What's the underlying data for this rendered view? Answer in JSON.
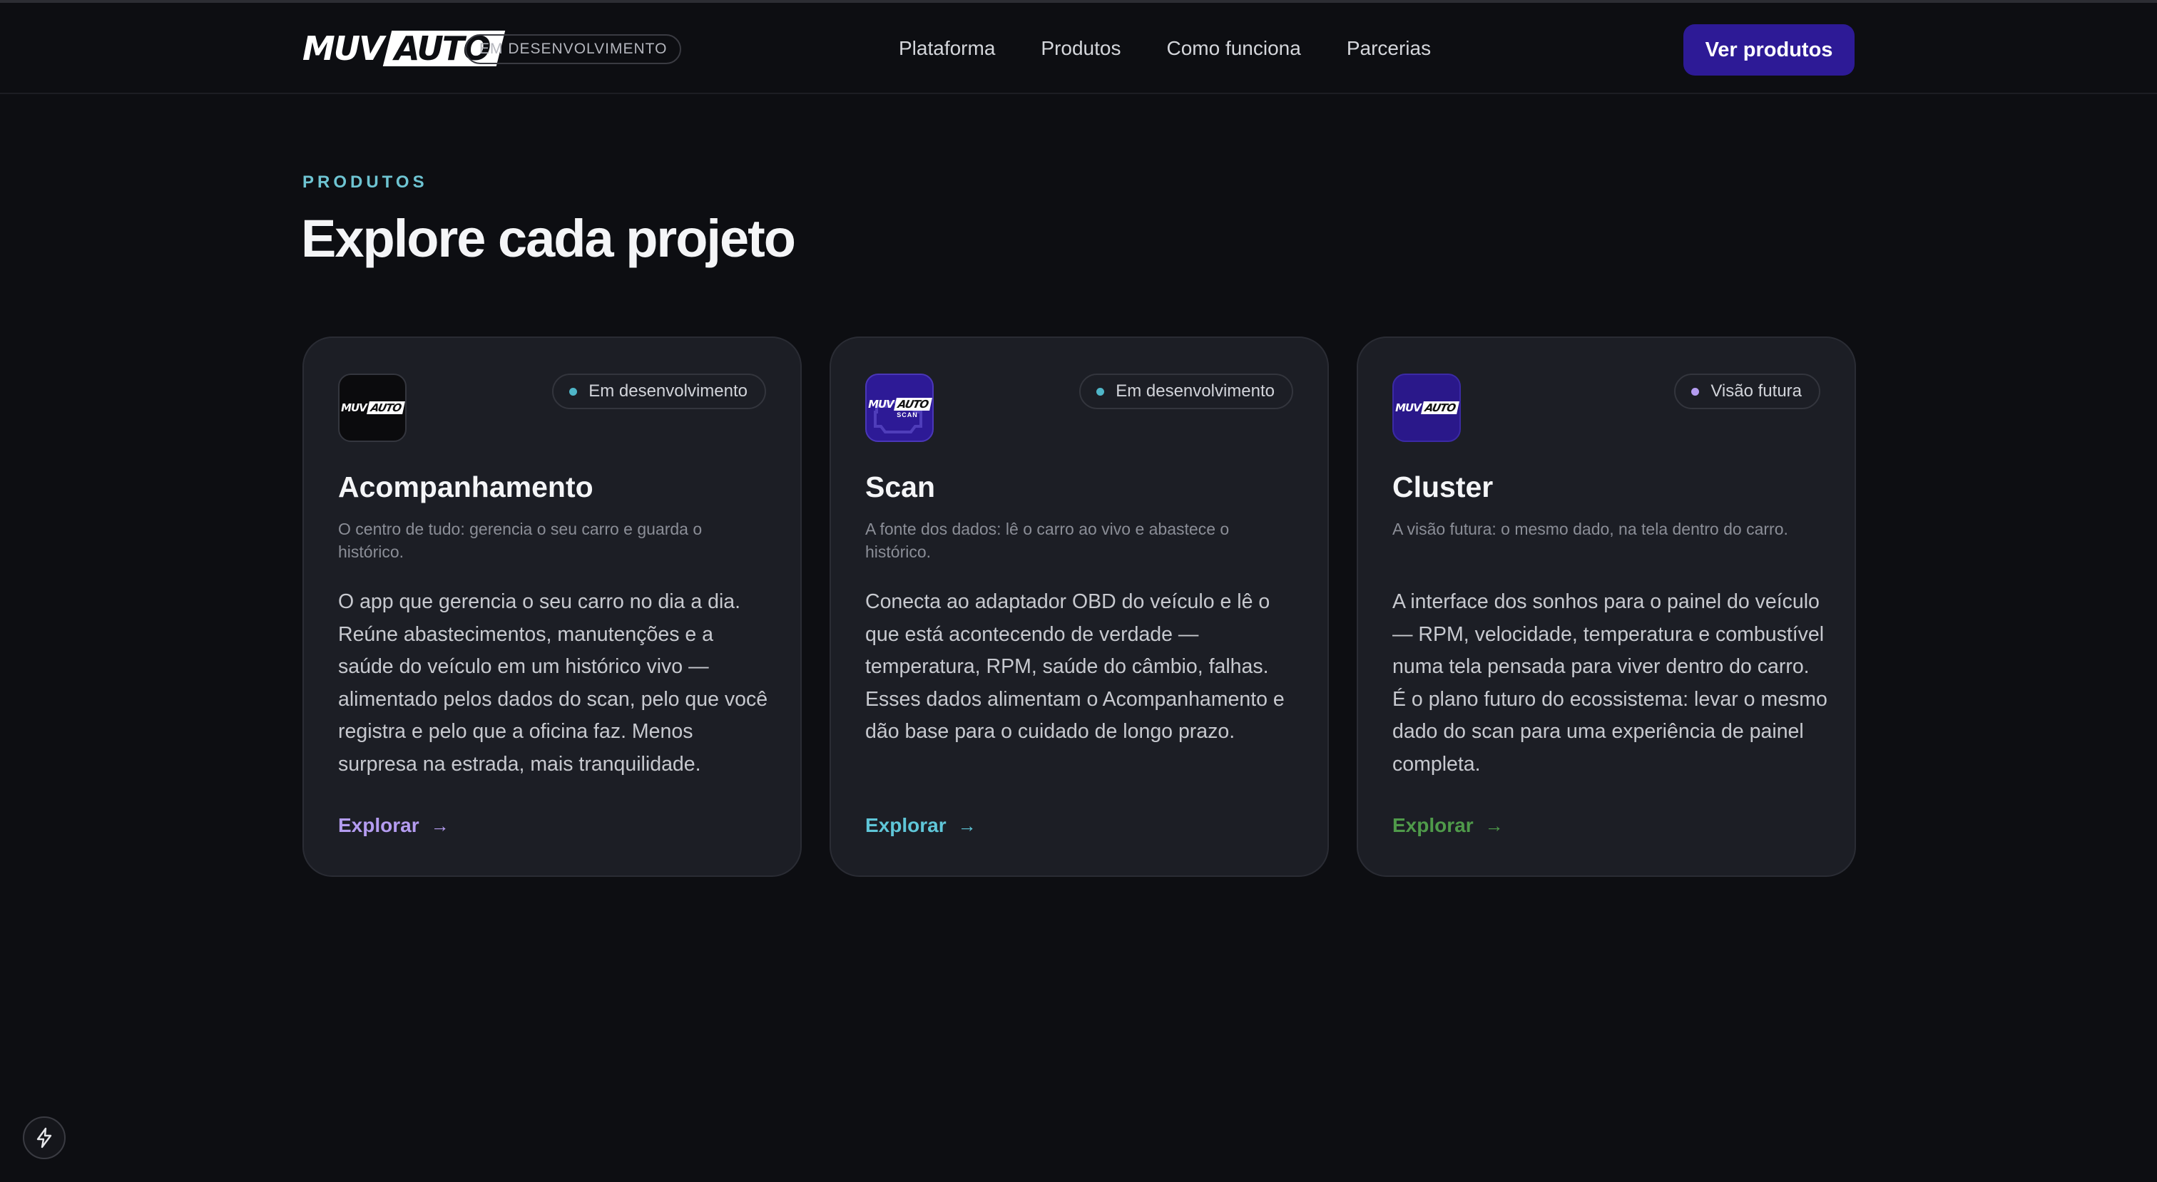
{
  "header": {
    "logo_left": "MUV",
    "logo_right": "AUTO",
    "dev_badge": "EM DESENVOLVIMENTO",
    "nav": [
      {
        "label": "Plataforma"
      },
      {
        "label": "Produtos"
      },
      {
        "label": "Como funciona"
      },
      {
        "label": "Parcerias"
      }
    ],
    "cta_label": "Ver produtos"
  },
  "section": {
    "eyebrow": "PRODUTOS",
    "title": "Explore cada projeto"
  },
  "icon_logo": {
    "left": "MUV",
    "right": "AUTO",
    "scan_sub": "SCAN"
  },
  "cards": [
    {
      "status": "Em desenvolvimento",
      "status_color": "#4fb6c8",
      "title": "Acompanhamento",
      "tagline": "O centro de tudo: gerencia o seu carro e guarda o histórico.",
      "description": "O app que gerencia o seu carro no dia a dia. Reúne abastecimentos, manutenções e a saúde do veículo em um histórico vivo — alimentado pelos dados do scan, pelo que você registra e pelo que a oficina faz. Menos surpresa na estrada, mais tranquilidade.",
      "link": "Explorar",
      "link_color": "#b49cf0",
      "icon": "muvauto-app-icon"
    },
    {
      "status": "Em desenvolvimento",
      "status_color": "#4fb6c8",
      "title": "Scan",
      "tagline": "A fonte dos dados: lê o carro ao vivo e abastece o histórico.",
      "description": "Conecta ao adaptador OBD do veículo e lê o que está acontecendo de verdade — temperatura, RPM, saúde do câmbio, falhas. Esses dados alimentam o Acompanhamento e dão base para o cuidado de longo prazo.",
      "link": "Explorar",
      "link_color": "#5fc6d8",
      "icon": "muvauto-scan-icon"
    },
    {
      "status": "Visão futura",
      "status_color": "#b49cf0",
      "title": "Cluster",
      "tagline": "A visão futura: o mesmo dado, na tela dentro do carro.",
      "description": "A interface dos sonhos para o painel do veículo — RPM, velocidade, temperatura e combustível numa tela pensada para viver dentro do carro. É o plano futuro do ecossistema: levar o mesmo dado do scan para uma experiência de painel completa.",
      "link": "Explorar",
      "link_color": "#4f9a4a",
      "icon": "muvauto-cluster-icon"
    }
  ],
  "colors": {
    "background": "#0d0e12",
    "card": "#1c1e25",
    "accent": "#2d1a96",
    "eyebrow": "#6ec4d2"
  }
}
